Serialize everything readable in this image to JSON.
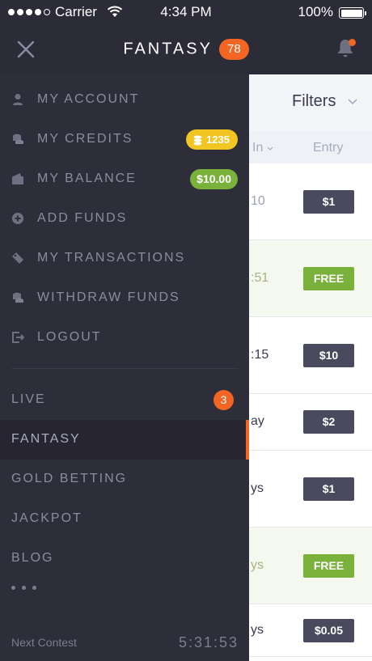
{
  "status_bar": {
    "carrier": "Carrier",
    "time": "4:34 PM",
    "battery": "100%",
    "signal_bars": 4
  },
  "header": {
    "title": "FANTASY",
    "count": "78",
    "icons": {
      "close": "close-icon",
      "notifications": "bell-icon"
    },
    "accent_color": "#f26522"
  },
  "menu": {
    "items": [
      {
        "label": "MY ACCOUNT",
        "icon": "user-icon"
      },
      {
        "label": "MY CREDITS",
        "icon": "coins-icon",
        "badge": "1235",
        "badge_color": "#f2c523"
      },
      {
        "label": "MY BALANCE",
        "icon": "wallet-icon",
        "badge": "$10.00",
        "badge_color": "#79b13a"
      },
      {
        "label": "ADD FUNDS",
        "icon": "plus-circle-icon"
      },
      {
        "label": "MY TRANSACTIONS",
        "icon": "tag-icon"
      },
      {
        "label": "WITHDRAW FUNDS",
        "icon": "coins-icon"
      },
      {
        "label": "LOGOUT",
        "icon": "logout-icon"
      }
    ]
  },
  "sections": {
    "items": [
      {
        "label": "LIVE",
        "badge": "3"
      },
      {
        "label": "FANTASY",
        "active": true
      },
      {
        "label": "GOLD BETTING"
      },
      {
        "label": "JACKPOT"
      },
      {
        "label": "BLOG"
      }
    ]
  },
  "footer": {
    "next_label": "Next Contest",
    "timer": "5:31:53"
  },
  "content": {
    "filters_label": "Filters",
    "columns": {
      "starts_in": "In",
      "entry": "Entry"
    },
    "rows": [
      {
        "time": "10",
        "entry": "$1",
        "free": false
      },
      {
        "time": ":51",
        "entry": "FREE",
        "free": true
      },
      {
        "time": ":15",
        "entry": "$10",
        "free": false
      },
      {
        "time": "ay",
        "entry": "$2",
        "free": false
      },
      {
        "time": "ys",
        "entry": "$1",
        "free": false
      },
      {
        "time": "ys",
        "entry": "FREE",
        "free": true
      },
      {
        "time": "ys",
        "entry": "$0.05",
        "free": false
      }
    ]
  }
}
